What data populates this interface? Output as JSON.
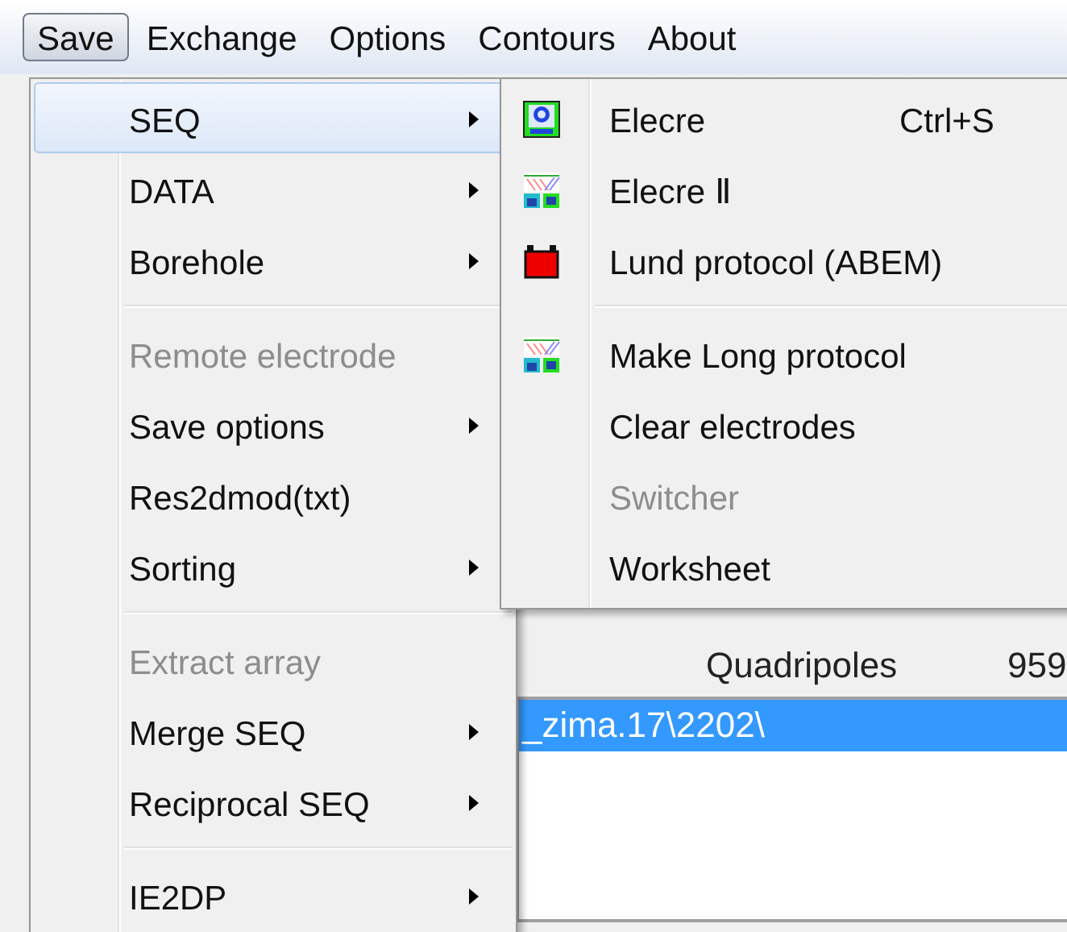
{
  "menu_bar": [
    {
      "label": "Save",
      "selected": true
    },
    {
      "label": "Exchange",
      "selected": false
    },
    {
      "label": "Options",
      "selected": false
    },
    {
      "label": "Contours",
      "selected": false
    },
    {
      "label": "About",
      "selected": false
    }
  ],
  "menu": [
    {
      "kind": "item",
      "label": "SEQ",
      "submenu": true,
      "disabled": false,
      "selected": true
    },
    {
      "kind": "item",
      "label": "DATA",
      "submenu": true,
      "disabled": false,
      "selected": false
    },
    {
      "kind": "item",
      "label": "Borehole",
      "submenu": true,
      "disabled": false,
      "selected": false
    },
    {
      "kind": "separator"
    },
    {
      "kind": "item",
      "label": "Remote electrode",
      "submenu": false,
      "disabled": true,
      "selected": false
    },
    {
      "kind": "item",
      "label": "Save options",
      "submenu": true,
      "disabled": false,
      "selected": false
    },
    {
      "kind": "item",
      "label": "Res2dmod(txt)",
      "submenu": false,
      "disabled": false,
      "selected": false
    },
    {
      "kind": "item",
      "label": "Sorting",
      "submenu": true,
      "disabled": false,
      "selected": false
    },
    {
      "kind": "separator"
    },
    {
      "kind": "item",
      "label": "Extract array",
      "submenu": false,
      "disabled": true,
      "selected": false
    },
    {
      "kind": "item",
      "label": "Merge SEQ",
      "submenu": true,
      "disabled": false,
      "selected": false
    },
    {
      "kind": "item",
      "label": "Reciprocal SEQ",
      "submenu": true,
      "disabled": false,
      "selected": false
    },
    {
      "kind": "separator"
    },
    {
      "kind": "item",
      "label": "IE2DP",
      "submenu": true,
      "disabled": false,
      "selected": false
    }
  ],
  "submenu": [
    {
      "kind": "item",
      "label": "Elecre",
      "shortcut": "Ctrl+S",
      "disabled": false
    },
    {
      "kind": "item",
      "label": "Elecre Ⅱ",
      "disabled": false
    },
    {
      "kind": "item",
      "label": "Lund protocol (ABEM)",
      "disabled": false
    },
    {
      "kind": "separator"
    },
    {
      "kind": "item",
      "label": "Make Long protocol",
      "disabled": false
    },
    {
      "kind": "item",
      "label": "Clear electrodes",
      "disabled": false
    },
    {
      "kind": "item",
      "label": "Switcher",
      "disabled": true
    },
    {
      "kind": "item",
      "label": "Worksheet",
      "disabled": false
    }
  ],
  "background": {
    "quadripoles_label": "Quadripoles",
    "quadripoles_value": "959",
    "path_row": {
      "text": "_zima.17\\2202\\",
      "selected": true
    }
  }
}
